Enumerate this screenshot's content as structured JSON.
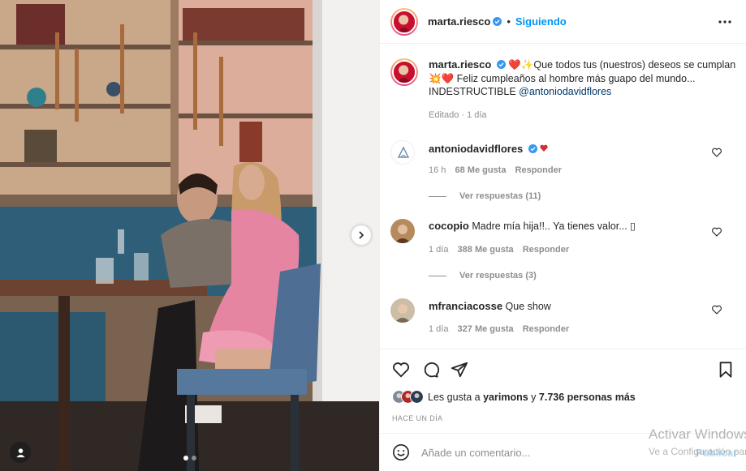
{
  "post": {
    "author": "marta.riesco",
    "follow_status": "Siguiendo",
    "separator": "•",
    "carousel": {
      "current_slide": 1,
      "total_slides": 2
    }
  },
  "caption": {
    "username": "marta.riesco",
    "text_line1": "❤️✨Que todos tus (nuestros) deseos se cumplan",
    "text_line2": "💥❤️ Feliz cumpleaños al hombre más guapo del mundo...",
    "text_line3": "INDESTRUCTIBLE ",
    "mention": "@antoniodavidflores",
    "meta": "Editado · 1 día"
  },
  "comments": [
    {
      "username": "antoniodavidflores",
      "text": "",
      "time": "16 h",
      "likes": "68 Me gusta",
      "reply_label": "Responder",
      "view_replies": "Ver respuestas (11)"
    },
    {
      "username": "cocopio",
      "text": "Madre mía hija!!.. Ya tienes valor... ▯",
      "time": "1 día",
      "likes": "388 Me gusta",
      "reply_label": "Responder",
      "view_replies": "Ver respuestas (3)"
    },
    {
      "username": "mfranciacosse",
      "text": "Que show",
      "time": "1 día",
      "likes": "327 Me gusta",
      "reply_label": "Responder"
    }
  ],
  "likes": {
    "prefix": "Les gusta a ",
    "user": "yarimons",
    "middle": " y ",
    "others": "7.736 personas más"
  },
  "timestamp": "HACE UN DÍA",
  "comment_box": {
    "placeholder": "Añade un comentario...",
    "publish_label": "Publicar"
  },
  "watermark": {
    "line1": "Activar Windows",
    "line2": "Ve a Configuración para activar Windows."
  },
  "colors": {
    "accent": "#0095f6",
    "verified": "#3897f0",
    "border": "#efefef",
    "muted": "#8e8e8e"
  }
}
